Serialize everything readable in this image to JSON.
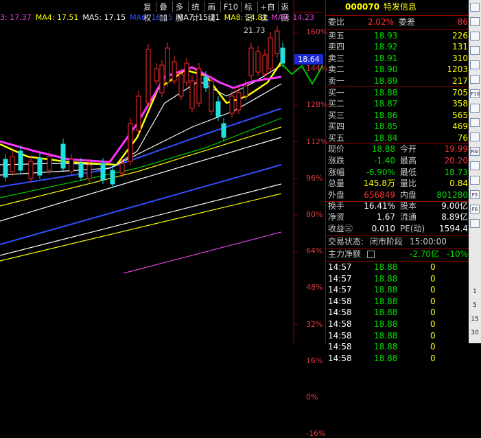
{
  "toolbar": [
    "复权",
    "叠加",
    "多股",
    "统计",
    "画线",
    "F10",
    "标记",
    "+自选",
    "返回"
  ],
  "ma_legend": [
    {
      "text": "3: 17.37",
      "color": "#e040e0"
    },
    {
      "text": "MA4: 17.51",
      "color": "#ffff00"
    },
    {
      "text": "MA5: 17.15",
      "color": "#ffffff"
    },
    {
      "text": "MA6: 16.15",
      "color": "#3050ff"
    },
    {
      "text": "MA7: 15.21",
      "color": "#ffffff"
    },
    {
      "text": "MA8: 14.81",
      "color": "#ffff00"
    },
    {
      "text": "MA9: 14.23",
      "color": "#e040e0"
    }
  ],
  "y_labels": [
    "160%",
    "144%",
    "128%",
    "112%",
    "96%",
    "80%",
    "64%",
    "48%",
    "32%",
    "16%",
    "0%",
    "-16%"
  ],
  "peak_label": "21.73",
  "current_price_tag": "18.64",
  "stock": {
    "code": "000070",
    "name": "特发信息"
  },
  "weibi": {
    "label": "委比",
    "pct": "2.02%",
    "label2": "委差",
    "value": "86"
  },
  "asks": [
    {
      "label": "卖五",
      "price": "18.93",
      "vol": "226"
    },
    {
      "label": "卖四",
      "price": "18.92",
      "vol": "131"
    },
    {
      "label": "卖三",
      "price": "18.91",
      "vol": "310"
    },
    {
      "label": "卖二",
      "price": "18.90",
      "vol": "1203"
    },
    {
      "label": "卖一",
      "price": "18.89",
      "vol": "217"
    }
  ],
  "bids": [
    {
      "label": "买一",
      "price": "18.88",
      "vol": "705"
    },
    {
      "label": "买二",
      "price": "18.87",
      "vol": "358"
    },
    {
      "label": "买三",
      "price": "18.86",
      "vol": "565"
    },
    {
      "label": "买四",
      "price": "18.85",
      "vol": "469"
    },
    {
      "label": "买五",
      "price": "18.84",
      "vol": "76"
    }
  ],
  "quote": [
    {
      "l1": "现价",
      "v1": "18.88",
      "c1": "g",
      "l2": "今开",
      "v2": "19.99",
      "c2": "r"
    },
    {
      "l1": "涨跌",
      "v1": "-1.40",
      "c1": "g",
      "l2": "最高",
      "v2": "20.20",
      "c2": "r"
    },
    {
      "l1": "涨幅",
      "v1": "-6.90%",
      "c1": "g",
      "l2": "最低",
      "v2": "18.73",
      "c2": "g"
    },
    {
      "l1": "总量",
      "v1": "145.8万",
      "c1": "y",
      "l2": "量比",
      "v2": "0.84",
      "c2": "y"
    },
    {
      "l1": "外盘",
      "v1": "656849",
      "c1": "r",
      "l2": "内盘",
      "v2": "801280",
      "c2": "g"
    }
  ],
  "stats": [
    {
      "l1": "换手",
      "v1": "16.41%",
      "l2": "股本",
      "v2": "9.00亿"
    },
    {
      "l1": "净资",
      "v1": "1.67",
      "l2": "流通",
      "v2": "8.89亿"
    },
    {
      "l1": "收益㊂",
      "v1": "0.010",
      "l2": "PE(动)",
      "v2": "1594.4"
    }
  ],
  "trade_status": {
    "label": "交易状态:",
    "phase": "闭市阶段",
    "time": "15:00:00"
  },
  "net_flow": {
    "label": "主力净额",
    "value": "-2.70亿",
    "pct": "-10%"
  },
  "ticks": [
    {
      "time": "14:57",
      "price": "18.88",
      "vol": "0"
    },
    {
      "time": "14:57",
      "price": "18.88",
      "vol": "0"
    },
    {
      "time": "14:57",
      "price": "18.88",
      "vol": "0"
    },
    {
      "time": "14:58",
      "price": "18.88",
      "vol": "0"
    },
    {
      "time": "14:58",
      "price": "18.88",
      "vol": "0"
    },
    {
      "time": "14:58",
      "price": "18.88",
      "vol": "0"
    },
    {
      "time": "14:58",
      "price": "18.88",
      "vol": "0"
    },
    {
      "time": "14:58",
      "price": "18.88",
      "vol": "0"
    },
    {
      "time": "14:58",
      "price": "18.88",
      "vol": "0"
    }
  ],
  "sidebar_icons": [
    "up-arrow-icon",
    "list-icon",
    "chart-icon",
    "bars-icon",
    "grid-icon",
    "ticker-icon",
    "f10-icon",
    "news-icon",
    "window-icon",
    "fundamental-icon",
    "rsi-icon",
    "cross-icon",
    "scroll-icon",
    "f5-icon",
    "f6-icon",
    "down-arrow-icon"
  ],
  "sidebar_labels": [
    "F10",
    "RSI",
    "F5",
    "F6"
  ],
  "sidebar_numbers": [
    "1",
    "5",
    "15",
    "30"
  ]
}
